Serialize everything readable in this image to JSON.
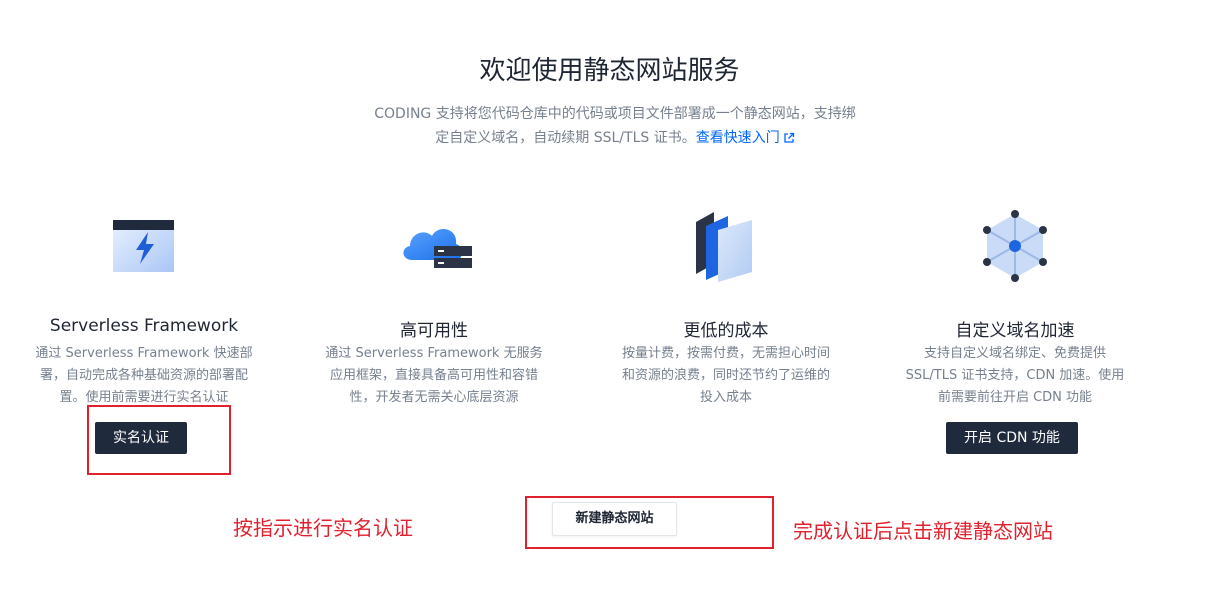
{
  "header": {
    "title": "欢迎使用静态网站服务",
    "intro_line1": "CODING 支持将您代码仓库中的代码或项目文件部署成一个静态网站，支持绑",
    "intro_line2": "定自定义域名，自动续期 SSL/TLS 证书。",
    "quickstart_link": "查看快速入门"
  },
  "features": [
    {
      "title": "Serverless Framework",
      "desc": "通过 Serverless Framework 快速部署，自动完成各种基础资源的部署配置。使用前需要进行实名认证",
      "icon": "serverless-icon",
      "button": "实名认证"
    },
    {
      "title": "高可用性",
      "desc": "通过 Serverless Framework 无服务应用框架，直接具备高可用性和容错性，开发者无需关心底层资源",
      "icon": "cloud-server-icon"
    },
    {
      "title": "更低的成本",
      "desc": "按量计费，按需付费，无需担心时间和资源的浪费，同时还节约了运维的投入成本",
      "icon": "layers-icon"
    },
    {
      "title": "自定义域名加速",
      "desc": "支持自定义域名绑定、免费提供 SSL/TLS 证书支持，CDN 加速。使用前需要前往开启 CDN 功能",
      "icon": "network-hub-icon",
      "button": "开启 CDN 功能"
    }
  ],
  "actions": {
    "new_site": "新建静态网站"
  },
  "annotations": {
    "left": "按指示进行实名认证",
    "right": "完成认证后点击新建静态网站"
  },
  "colors": {
    "accent": "#0066ff",
    "button_dark": "#1f2a3c",
    "annotation_red": "#e0212e"
  }
}
